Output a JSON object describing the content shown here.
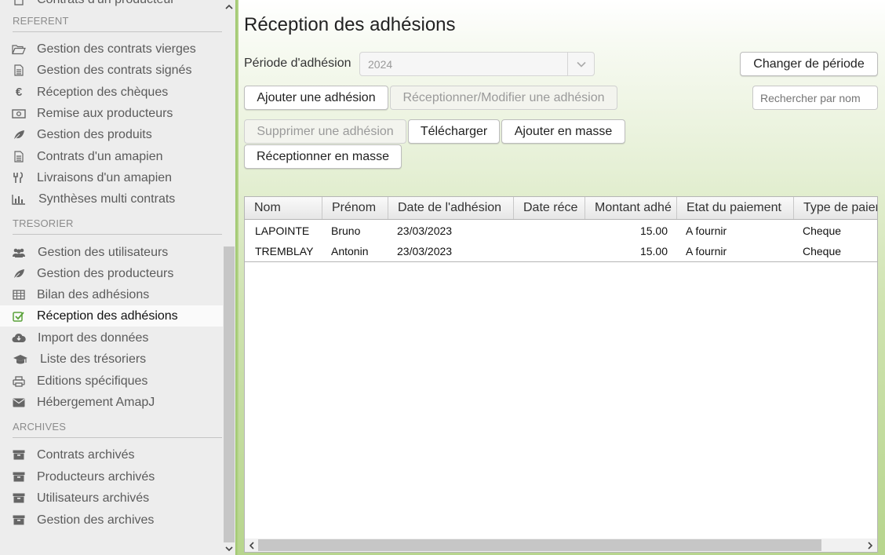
{
  "sidebar": {
    "partial_top_item": "Contrats d'un producteur",
    "sections": {
      "referent": "REFERENT",
      "tresorier": "TRESORIER",
      "archives": "ARCHIVES"
    },
    "referent_items": [
      {
        "label": "Gestion des contrats vierges",
        "icon": "folder-open-icon"
      },
      {
        "label": "Gestion des contrats signés",
        "icon": "document-icon"
      },
      {
        "label": "Réception des chèques",
        "icon": "euro-icon"
      },
      {
        "label": "Remise aux producteurs",
        "icon": "money-icon"
      },
      {
        "label": "Gestion des produits",
        "icon": "leaf-icon"
      },
      {
        "label": "Contrats d'un amapien",
        "icon": "document-icon"
      },
      {
        "label": "Livraisons d'un amapien",
        "icon": "cutlery-icon"
      },
      {
        "label": "Synthèses multi contrats",
        "icon": "bar-chart-icon"
      }
    ],
    "tresorier_items": [
      {
        "label": "Gestion des utilisateurs",
        "icon": "users-icon"
      },
      {
        "label": "Gestion des producteurs",
        "icon": "leaf-icon"
      },
      {
        "label": "Bilan des adhésions",
        "icon": "table-icon"
      },
      {
        "label": "Réception des adhésions",
        "icon": "check-square-icon"
      },
      {
        "label": "Import des données",
        "icon": "cloud-download-icon"
      },
      {
        "label": "Liste des trésoriers",
        "icon": "graduation-cap-icon"
      },
      {
        "label": "Editions spécifiques",
        "icon": "print-icon"
      },
      {
        "label": "Hébergement AmapJ",
        "icon": "envelope-icon"
      }
    ],
    "archives_items": [
      {
        "label": "Contrats archivés",
        "icon": "archive-icon"
      },
      {
        "label": "Producteurs archivés",
        "icon": "archive-icon"
      },
      {
        "label": "Utilisateurs archivés",
        "icon": "archive-icon"
      },
      {
        "label": "Gestion des archives",
        "icon": "archive-icon"
      }
    ],
    "selected": "Réception des adhésions"
  },
  "main": {
    "title": "Réception des adhésions",
    "periode_label": "Période d'adhésion",
    "periode_value": "2024",
    "buttons": {
      "changer_periode": "Changer de période",
      "ajouter": "Ajouter une adhésion",
      "receptionner_modifier": "Réceptionner/Modifier une adhésion",
      "supprimer": "Supprimer une adhésion",
      "telecharger": "Télécharger",
      "ajouter_masse": "Ajouter en masse",
      "receptionner_masse": "Réceptionner en masse"
    },
    "search_placeholder": "Rechercher par nom",
    "table": {
      "columns": [
        "Nom",
        "Prénom",
        "Date de l'adhésion",
        "Date réce",
        "Montant adhé",
        "Etat du paiement",
        "Type de paien"
      ],
      "rows": [
        [
          "LAPOINTE",
          "Bruno",
          "23/03/2023",
          "",
          "15.00",
          "A fournir",
          "Cheque"
        ],
        [
          "TREMBLAY",
          "Antonin",
          "23/03/2023",
          "",
          "15.00",
          "A fournir",
          "Cheque"
        ]
      ]
    }
  },
  "colors": {
    "accent_green": "#5aa23a",
    "sidebar_bg": "#ededed"
  }
}
